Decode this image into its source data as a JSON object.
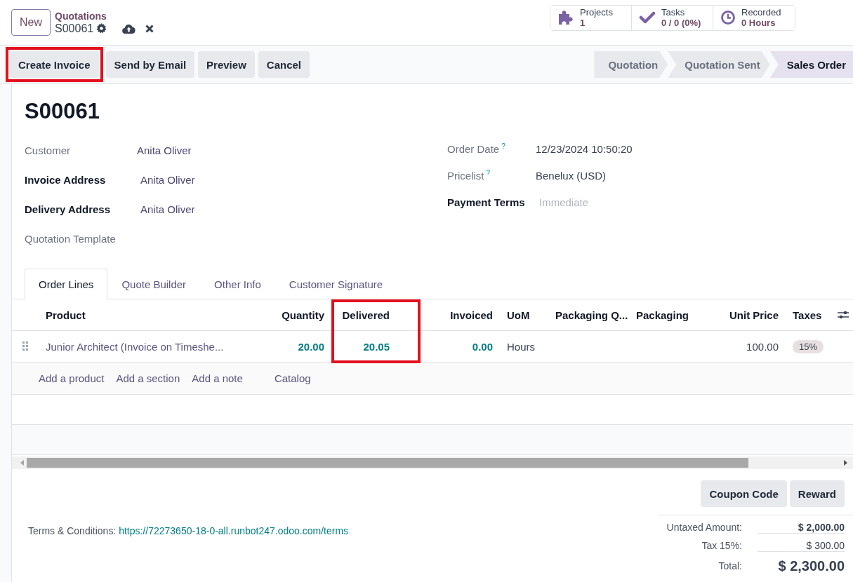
{
  "breadcrumb": {
    "new_button": "New",
    "parent": "Quotations",
    "record": "S00061"
  },
  "stat_buttons": [
    {
      "label": "Projects",
      "value": "1"
    },
    {
      "label": "Tasks",
      "value": "0 / 0 (0%)"
    },
    {
      "label": "Recorded",
      "value": "0 Hours"
    }
  ],
  "actions": [
    {
      "label": "Create Invoice",
      "highlighted": true
    },
    {
      "label": "Send by Email"
    },
    {
      "label": "Preview"
    },
    {
      "label": "Cancel"
    }
  ],
  "status_bar": [
    {
      "label": "Quotation",
      "selected": false
    },
    {
      "label": "Quotation Sent",
      "selected": false
    },
    {
      "label": "Sales Order",
      "selected": true
    }
  ],
  "title": "S00061",
  "left_fields": [
    {
      "label": "Customer",
      "value": "Anita Oliver",
      "required": false
    },
    {
      "label": "Invoice Address",
      "value": "Anita Oliver",
      "required": true
    },
    {
      "label": "Delivery Address",
      "value": "Anita Oliver",
      "required": true
    },
    {
      "label": "Quotation Template",
      "required": false
    }
  ],
  "right_fields": [
    {
      "label": "Order Date",
      "help_mark": "?",
      "value": "12/23/2024 10:50:20",
      "required": false
    },
    {
      "label": "Pricelist",
      "help_mark": "?",
      "value": "Benelux (USD)",
      "required": false
    },
    {
      "label": "Payment Terms",
      "placeholder": "Immediate",
      "required": true
    }
  ],
  "tabs": [
    {
      "label": "Order Lines",
      "selected": true
    },
    {
      "label": "Quote Builder",
      "selected": false
    },
    {
      "label": "Other Info",
      "selected": false
    },
    {
      "label": "Customer Signature",
      "selected": false
    }
  ],
  "table": {
    "columns": [
      {
        "label": "Product",
        "kind": "text"
      },
      {
        "label": "Quantity",
        "kind": "number"
      },
      {
        "label": "Delivered",
        "kind": "number",
        "highlighted": true
      },
      {
        "label": "Invoiced",
        "kind": "number"
      },
      {
        "label": "UoM",
        "kind": "text"
      },
      {
        "label": "Packaging Q...",
        "kind": "text"
      },
      {
        "label": "Packaging",
        "kind": "text"
      },
      {
        "label": "Unit Price",
        "kind": "number"
      },
      {
        "label": "Taxes",
        "kind": "text"
      }
    ],
    "rows": [
      {
        "cells": [
          {
            "kind": "link",
            "text": "Junior Architect (Invoice on Timeshe..."
          },
          {
            "kind": "number",
            "text": "20.00"
          },
          {
            "kind": "number",
            "text": "20.05"
          },
          {
            "kind": "number",
            "text": "0.00"
          },
          {
            "kind": "text",
            "text": "Hours"
          },
          {
            "kind": "empty"
          },
          {
            "kind": "empty"
          },
          {
            "kind": "plain-number",
            "text": "100.00"
          },
          {
            "kind": "tag",
            "text": "15%"
          }
        ]
      }
    ],
    "add_links": [
      "Add a product",
      "Add a section",
      "Add a note",
      "Catalog"
    ]
  },
  "footer_buttons": [
    "Coupon Code",
    "Reward"
  ],
  "terms": {
    "label": "Terms & Conditions:",
    "link": "https://72273650-18-0-all.runbot247.odoo.com/terms"
  },
  "totals": [
    {
      "label": "Untaxed Amount:",
      "value": "$ 2,000.00",
      "kind": "bold"
    },
    {
      "label": "Tax 15%:",
      "value": "$ 300.00",
      "kind": "normal"
    },
    {
      "label": "Total:",
      "value": "$ 2,300.00",
      "kind": "grand"
    }
  ]
}
